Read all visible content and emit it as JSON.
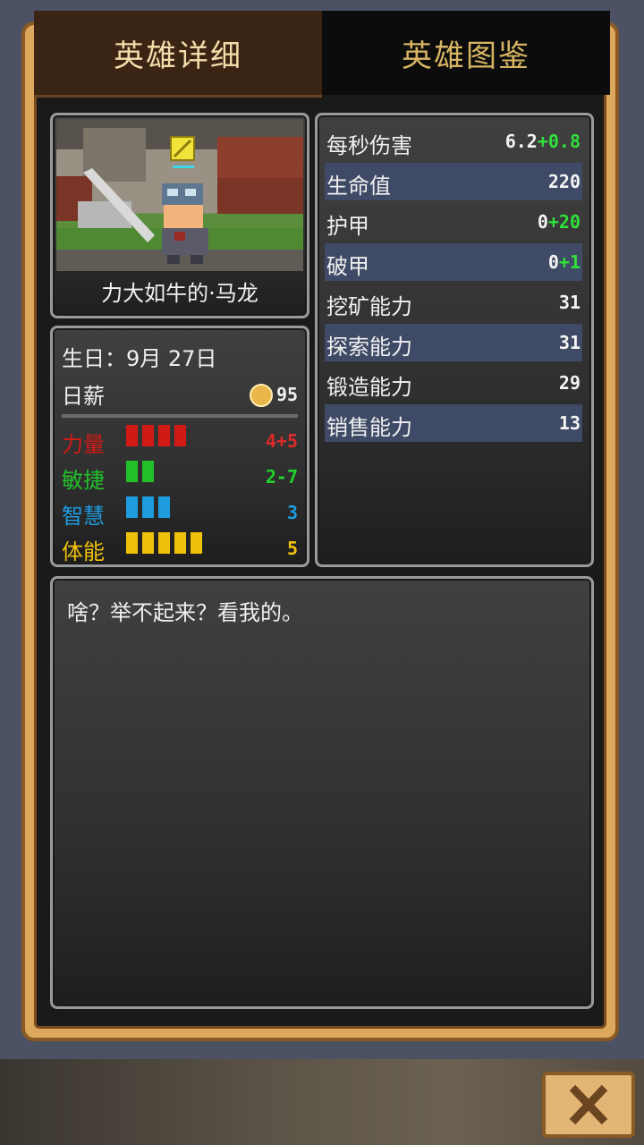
{
  "tabs": {
    "details": "英雄详细",
    "atlas": "英雄图鉴"
  },
  "hero": {
    "name": "力大如牛的·马龙",
    "birthday": "生日：9月 27日",
    "wage_label": "日薪",
    "wage_value": "95"
  },
  "attributes": [
    {
      "label": "力量",
      "value": "4+5",
      "bars": 4,
      "color": "#d11a16"
    },
    {
      "label": "敏捷",
      "value": "2-7",
      "bars": 2,
      "color": "#22c12a"
    },
    {
      "label": "智慧",
      "value": "3",
      "bars": 3,
      "color": "#1f9be0"
    },
    {
      "label": "体能",
      "value": "5",
      "bars": 5,
      "color": "#f0c10a"
    }
  ],
  "stats": [
    {
      "label": "每秒伤害",
      "value": "6.2",
      "bonus": "+0.8"
    },
    {
      "label": "生命值",
      "value": "220",
      "bonus": ""
    },
    {
      "label": "护甲",
      "value": "0",
      "bonus": "+20"
    },
    {
      "label": "破甲",
      "value": "0",
      "bonus": "+1"
    },
    {
      "label": "挖矿能力",
      "value": "31",
      "bonus": ""
    },
    {
      "label": "探索能力",
      "value": "31",
      "bonus": ""
    },
    {
      "label": "锻造能力",
      "value": "29",
      "bonus": ""
    },
    {
      "label": "销售能力",
      "value": "13",
      "bonus": ""
    }
  ],
  "quote": "啥？举不起来？看我的。",
  "icons": {
    "close": "close-icon",
    "coin": "coin-icon",
    "class": "sword-class-icon"
  }
}
